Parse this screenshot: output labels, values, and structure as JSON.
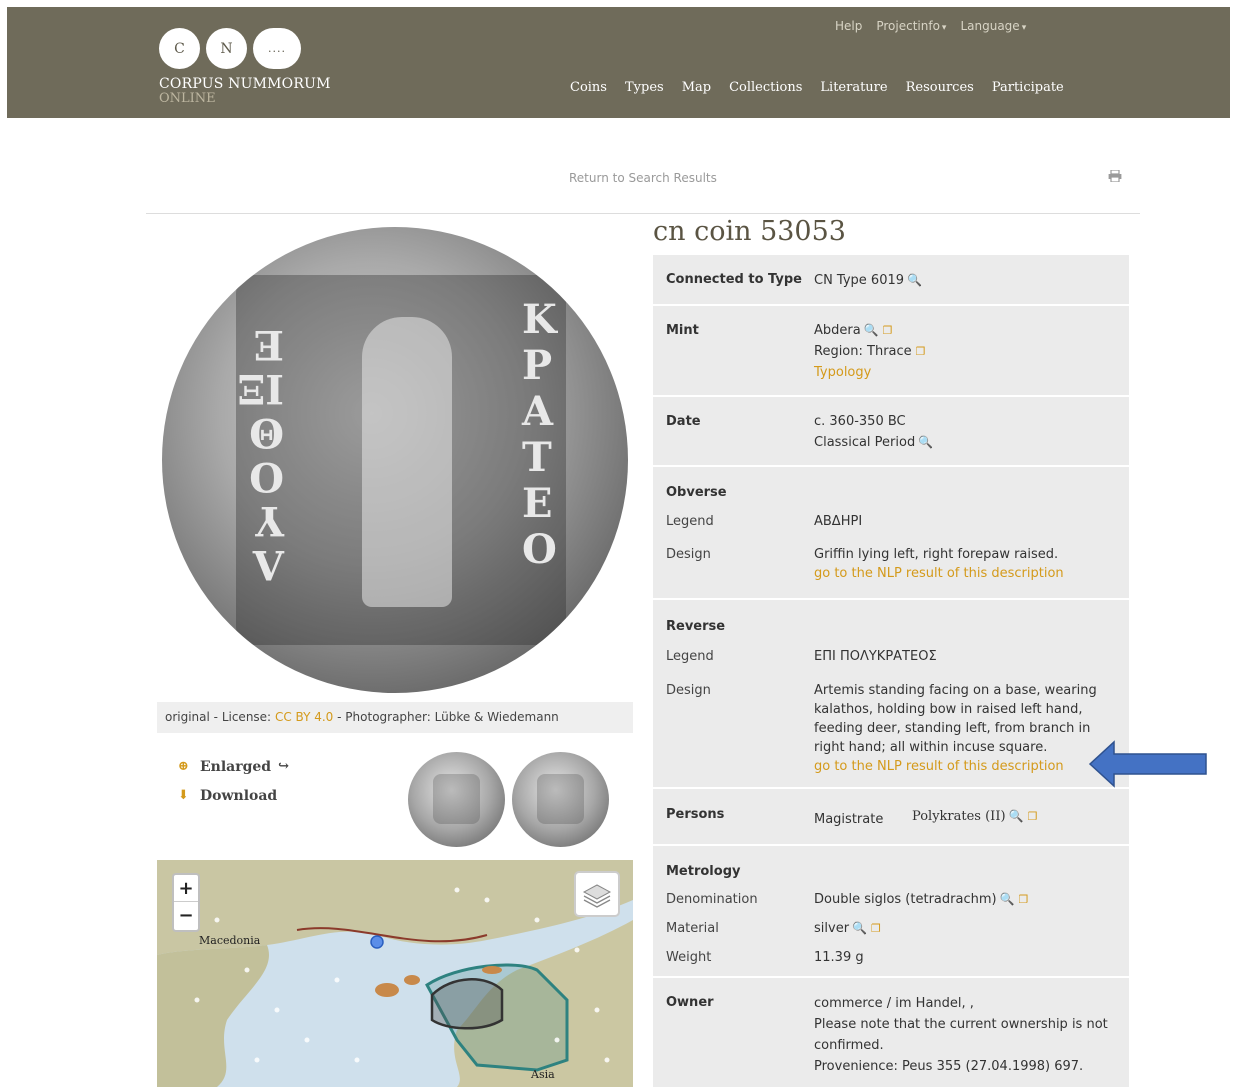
{
  "header": {
    "logo": {
      "letters": [
        "C",
        "N",
        "...."
      ],
      "title": "CORPUS NUMMORUM",
      "subtitle": "ONLINE"
    },
    "topnav": [
      {
        "label": "Help",
        "dropdown": false
      },
      {
        "label": "Projectinfo",
        "dropdown": true
      },
      {
        "label": "Language",
        "dropdown": true
      }
    ],
    "mainnav": [
      "Coins",
      "Types",
      "Map",
      "Collections",
      "Literature",
      "Resources",
      "Participate"
    ]
  },
  "return_link": "Return to Search Results",
  "coin": {
    "title": "cn coin 53053",
    "image_text": {
      "left": "ΛΥΟΘΙΞΕ",
      "right": "ΚΡΑΤΕΟ"
    },
    "license": {
      "prefix": "original - License:",
      "license_link": "CC BY 4.0",
      "suffix": "- Photographer: Lübke & Wiedemann"
    },
    "actions": {
      "enlarged": "Enlarged",
      "download": "Download"
    }
  },
  "map": {
    "labels": [
      "Macedonia",
      "Asia"
    ],
    "zoom_in": "+",
    "zoom_out": "−"
  },
  "details": {
    "connected": {
      "label": "Connected to Type",
      "value": "CN Type 6019"
    },
    "mint": {
      "label": "Mint",
      "value": "Abdera",
      "region": "Region: Thrace",
      "typology": "Typology"
    },
    "date": {
      "label": "Date",
      "value": "c. 360-350 BC",
      "period": "Classical Period"
    },
    "obverse": {
      "label": "Obverse",
      "legend_label": "Legend",
      "legend": "ΑΒΔΗΡΙ",
      "design_label": "Design",
      "design": "Griffin lying left, right forepaw raised.",
      "nlp": "go to the NLP result of this description"
    },
    "reverse": {
      "label": "Reverse",
      "legend_label": "Legend",
      "legend": "ΕΠΙ ΠΟΛΥΚΡΑΤΕΟΣ",
      "design_label": "Design",
      "design": "Artemis standing facing on a base, wearing kalathos, holding bow in raised left hand, feeding deer, standing left, from branch in right hand; all within incuse square.",
      "nlp": "go to the NLP result of this description"
    },
    "persons": {
      "label": "Persons",
      "role": "Magistrate",
      "name": "Polykrates (II)"
    },
    "metrology": {
      "label": "Metrology",
      "denomination_label": "Denomination",
      "denomination": "Double siglos (tetradrachm)",
      "material_label": "Material",
      "material": "silver",
      "weight_label": "Weight",
      "weight": "11.39 g"
    },
    "owner": {
      "label": "Owner",
      "value": "commerce / im Handel, ,",
      "note": "Please note that the current ownership is not confirmed.",
      "provenience": "Provenience: Peus 355 (27.04.1998) 697."
    }
  },
  "colors": {
    "header_bg": "#6f6b5a",
    "accent": "#d49a1b",
    "panel_gray": "#ebebeb",
    "arrow": "#4472c4"
  }
}
